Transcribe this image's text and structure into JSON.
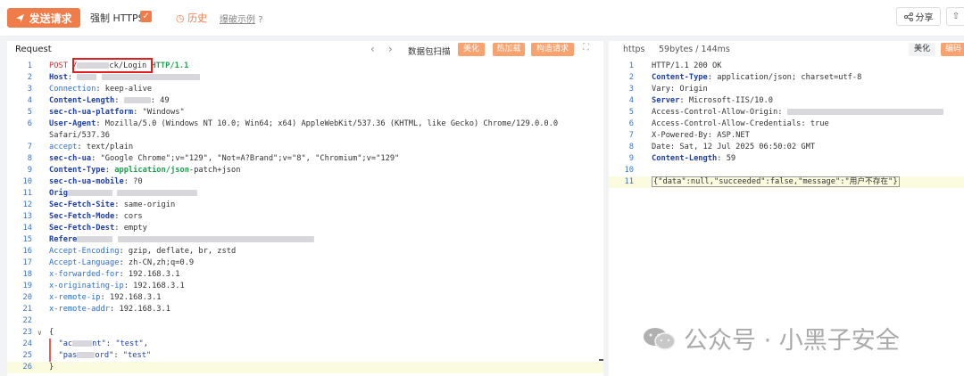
{
  "toolbar": {
    "send_label": "发送请求",
    "force_https_label": "强制 HTTPS",
    "history_label": "历史",
    "example_label": "爆破示例",
    "share_label": "分享"
  },
  "request": {
    "title": "Request",
    "tools": {
      "scan_label": "数据包扫描",
      "beautify_label": "美化",
      "hot_load_label": "热加载",
      "construct_label": "构造请求"
    },
    "lines": [
      {
        "n": "1",
        "parts": [
          {
            "t": "POST",
            "c": "meth"
          },
          {
            "t": " /"
          },
          {
            "b": 36
          },
          {
            "t": "ck/Login "
          },
          {
            "t": "HTTP/1.1",
            "c": "ver"
          }
        ]
      },
      {
        "n": "2",
        "parts": [
          {
            "t": "Host",
            "c": "kw"
          },
          {
            "t": ": "
          },
          {
            "b": 22
          },
          {
            "t": " "
          },
          {
            "b": 110
          }
        ]
      },
      {
        "n": "3",
        "parts": [
          {
            "t": "Connection",
            "c": "hn"
          },
          {
            "t": ": keep-alive"
          }
        ]
      },
      {
        "n": "4",
        "parts": [
          {
            "t": "Content-Length",
            "c": "kw"
          },
          {
            "t": ": "
          },
          {
            "b": 30
          },
          {
            "t": ": 49"
          }
        ]
      },
      {
        "n": "5",
        "parts": [
          {
            "t": "sec-ch-ua-platform",
            "c": "kw"
          },
          {
            "t": ": \"Windows\""
          }
        ]
      },
      {
        "n": "6",
        "parts": [
          {
            "t": "User-Agent",
            "c": "kw"
          },
          {
            "t": ": Mozilla/5.0 (Windows NT 10.0; Win64; x64) AppleWebKit/537.36 (KHTML, like Gecko) Chrome/129.0.0.0"
          }
        ]
      },
      {
        "n": "",
        "parts": [
          {
            "t": "Safari/537.36"
          }
        ]
      },
      {
        "n": "7",
        "parts": [
          {
            "t": "accept",
            "c": "hn"
          },
          {
            "t": ": text/plain"
          }
        ]
      },
      {
        "n": "8",
        "parts": [
          {
            "t": "sec-ch-ua",
            "c": "kw"
          },
          {
            "t": ": \"Google Chrome\";v=\"129\", \"Not=A?Brand\";v=\"8\", \"Chromium\";v=\"129\""
          }
        ]
      },
      {
        "n": "9",
        "parts": [
          {
            "t": "Content-Type",
            "c": "kw"
          },
          {
            "t": ": "
          },
          {
            "t": "application/json",
            "c": "ver"
          },
          {
            "t": "-patch+json"
          }
        ]
      },
      {
        "n": "10",
        "parts": [
          {
            "t": "sec-ch-ua-mobile",
            "c": "kw"
          },
          {
            "t": ": ?0"
          }
        ]
      },
      {
        "n": "11",
        "parts": [
          {
            "t": "Orig",
            "c": "kw"
          },
          {
            "b": 50
          },
          {
            "t": " "
          },
          {
            "b": 90
          }
        ]
      },
      {
        "n": "12",
        "parts": [
          {
            "t": "Sec-Fetch-Site",
            "c": "kw"
          },
          {
            "t": ": same-origin"
          }
        ]
      },
      {
        "n": "13",
        "parts": [
          {
            "t": "Sec-Fetch-Mode",
            "c": "kw"
          },
          {
            "t": ": cors"
          }
        ]
      },
      {
        "n": "14",
        "parts": [
          {
            "t": "Sec-Fetch-Dest",
            "c": "kw"
          },
          {
            "t": ": empty"
          }
        ]
      },
      {
        "n": "15",
        "parts": [
          {
            "t": "Refere",
            "c": "kw"
          },
          {
            "b": 40
          },
          {
            "t": " "
          },
          {
            "b": 220
          }
        ]
      },
      {
        "n": "16",
        "parts": [
          {
            "t": "Accept-Encoding",
            "c": "hn"
          },
          {
            "t": ": gzip, deflate, br, zstd"
          }
        ]
      },
      {
        "n": "17",
        "parts": [
          {
            "t": "Accept-Language",
            "c": "hn"
          },
          {
            "t": ": zh-CN,zh;q=0.9"
          }
        ]
      },
      {
        "n": "18",
        "parts": [
          {
            "t": "x-forwarded-for",
            "c": "hn"
          },
          {
            "t": ": 192.168.3.1"
          }
        ]
      },
      {
        "n": "19",
        "parts": [
          {
            "t": "x-originating-ip",
            "c": "hn"
          },
          {
            "t": ": 192.168.3.1"
          }
        ]
      },
      {
        "n": "20",
        "parts": [
          {
            "t": "x-remote-ip",
            "c": "hn"
          },
          {
            "t": ": 192.168.3.1"
          }
        ]
      },
      {
        "n": "21",
        "parts": [
          {
            "t": "x-remote-addr",
            "c": "hn"
          },
          {
            "t": ": 192.168.3.1"
          }
        ]
      },
      {
        "n": "22",
        "parts": []
      },
      {
        "n": "23",
        "parts": [
          {
            "t": "{"
          }
        ],
        "fold": true
      },
      {
        "n": "24",
        "parts": [
          {
            "t": "  \"ac",
            "c": "str"
          },
          {
            "b": 22
          },
          {
            "t": "nt\"",
            "c": "str"
          },
          {
            "t": ": "
          },
          {
            "t": "\"test\"",
            "c": "str"
          },
          {
            "t": ","
          }
        ],
        "mark": true
      },
      {
        "n": "25",
        "parts": [
          {
            "t": "  \"pas",
            "c": "str"
          },
          {
            "b": 20
          },
          {
            "t": "ord\"",
            "c": "str"
          },
          {
            "t": ": "
          },
          {
            "t": "\"test\"",
            "c": "str"
          }
        ],
        "mark": true
      },
      {
        "n": "26",
        "parts": [
          {
            "t": "}"
          }
        ],
        "hl": true
      }
    ]
  },
  "response": {
    "tab_https": "https",
    "tab_size": "59bytes / 144ms",
    "beautify_label": "美化",
    "encode_label": "编码",
    "lines": [
      {
        "n": "1",
        "parts": [
          {
            "t": "HTTP/1.1 200 OK"
          }
        ]
      },
      {
        "n": "2",
        "parts": [
          {
            "t": "Content-Type",
            "c": "kw"
          },
          {
            "t": ": application/json; charset=utf-8"
          }
        ]
      },
      {
        "n": "3",
        "parts": [
          {
            "t": "Vary: Origin"
          }
        ]
      },
      {
        "n": "4",
        "parts": [
          {
            "t": "Server",
            "c": "kw"
          },
          {
            "t": ": Microsoft-IIS/10.0"
          }
        ]
      },
      {
        "n": "5",
        "parts": [
          {
            "t": "Access-Control-Allow-Origin: "
          },
          {
            "b": 175
          }
        ]
      },
      {
        "n": "6",
        "parts": [
          {
            "t": "Access-Control-Allow-Credentials: true"
          }
        ]
      },
      {
        "n": "7",
        "parts": [
          {
            "t": "X-Powered-By: ASP.NET"
          }
        ]
      },
      {
        "n": "8",
        "parts": [
          {
            "t": "Date: Sat, 12 Jul 2025 06:50:02 GMT"
          }
        ]
      },
      {
        "n": "9",
        "parts": [
          {
            "t": "Content-Length",
            "c": "kw"
          },
          {
            "t": ": 59"
          }
        ]
      },
      {
        "n": "10",
        "parts": []
      },
      {
        "n": "11",
        "parts": [
          {
            "t": "{\"data\":null,\"succeeded\":false,\"message\":\"用户不存在\"}",
            "c": "json"
          }
        ],
        "hl": true
      }
    ]
  },
  "watermark": {
    "text": "公众号 · 小黑子安全"
  },
  "colors": {
    "accent": "#f07c4a",
    "keyword": "#1d3fa8",
    "line_number": "#3b73c4"
  }
}
